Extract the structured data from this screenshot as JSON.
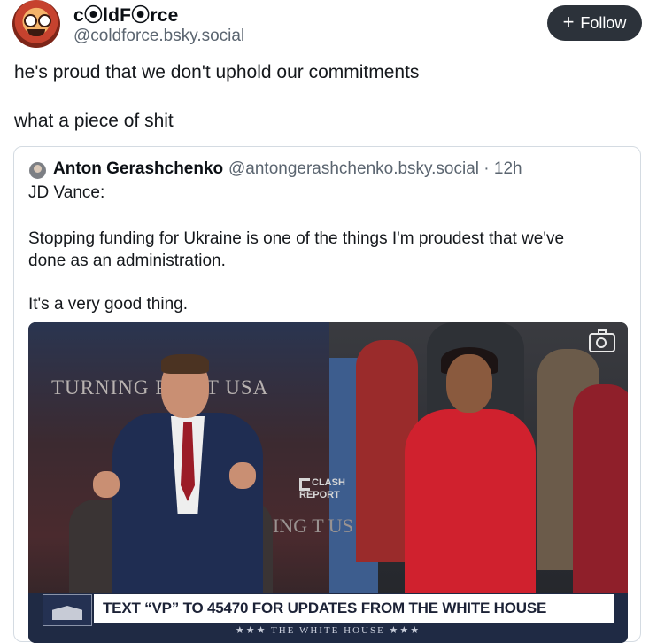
{
  "author": {
    "display_name": "c⦿ldF⦿rce",
    "handle": "@coldforce.bsky.social"
  },
  "follow_button": {
    "label": "Follow",
    "icon": "plus-icon"
  },
  "post": {
    "lines": [
      "he's proud that we don't uphold our commitments",
      "what a piece of shit"
    ]
  },
  "quote": {
    "author_name": "Anton Gerashchenko",
    "meta": "@antongerashchenko.bsky.social · 12h",
    "lines": [
      "JD Vance:",
      "Stopping funding for Ukraine is one of the things I'm proudest that we've",
      "done as an administration.",
      "It's a very good thing."
    ],
    "media": {
      "backdrop_text": "TURNING POINT USA",
      "backdrop_text_right": "ING T US",
      "watermark": "CLASH REPORT",
      "ticker": "TEXT “VP” TO 45470 FOR UPDATES FROM THE WHITE HOUSE",
      "ticker_sub": "★★★ THE WHITE HOUSE ★★★"
    }
  }
}
